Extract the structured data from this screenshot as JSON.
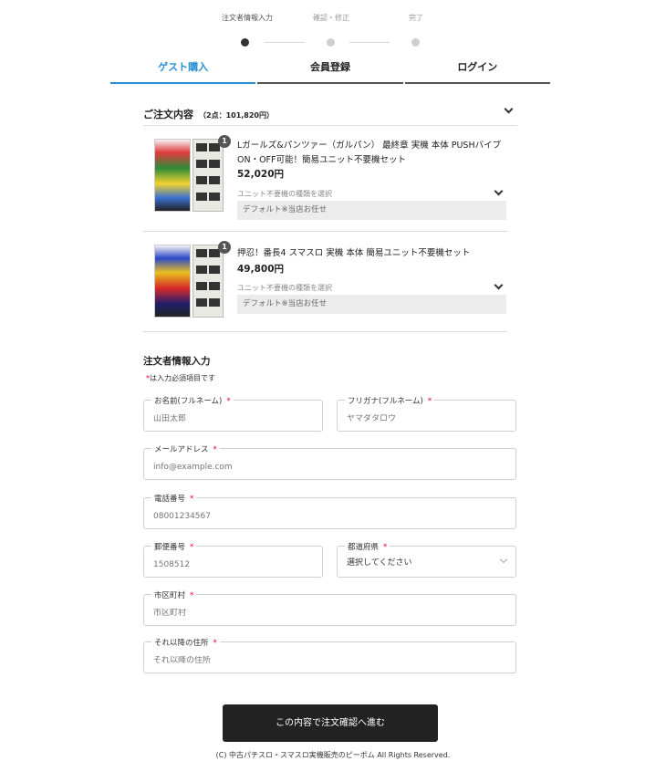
{
  "stepper": {
    "steps": [
      {
        "label": "注文者情報入力",
        "active": true
      },
      {
        "label": "確認・修正",
        "active": false
      },
      {
        "label": "完了",
        "active": false
      }
    ]
  },
  "tabs": [
    {
      "label": "ゲスト購入",
      "active": true
    },
    {
      "label": "会員登録",
      "active": false
    },
    {
      "label": "ログイン",
      "active": false
    }
  ],
  "order": {
    "title": "ご注文内容",
    "count": "（2点：101,820円）",
    "items": [
      {
        "qty": "1",
        "name": "Lガールズ&パンツァー（ガルパン） 最終章 実機 本体 PUSHバイブON・OFF可能！簡易ユニット不要機セット",
        "price": "52,020円",
        "unit_label": "ユニット不要機の種類を選択",
        "unit_value": "デフォルト※当店お任せ"
      },
      {
        "qty": "1",
        "name": "押忍！番長4 スマスロ 実機 本体 簡易ユニット不要機セット",
        "price": "49,800円",
        "unit_label": "ユニット不要機の種類を選択",
        "unit_value": "デフォルト※当店お任せ"
      }
    ]
  },
  "form": {
    "title": "注文者情報入力",
    "required_note": "は入力必須項目です",
    "required_mark": "*",
    "fields": {
      "name": {
        "label": "お名前(フルネーム)",
        "placeholder": "山田太郎"
      },
      "kana": {
        "label": "フリガナ(フルネーム)",
        "placeholder": "ヤマダタロウ"
      },
      "email": {
        "label": "メールアドレス",
        "placeholder": "info@example.com"
      },
      "phone": {
        "label": "電話番号",
        "placeholder": "08001234567"
      },
      "zip": {
        "label": "郵便番号",
        "placeholder": "1508512"
      },
      "pref": {
        "label": "都道府県",
        "value": "選択してください"
      },
      "city": {
        "label": "市区町村",
        "placeholder": "市区町村"
      },
      "address": {
        "label": "それ以降の住所",
        "placeholder": "それ以降の住所"
      }
    }
  },
  "submit_label": "この内容で注文確認へ進む",
  "footer": "(C) 中古パチスロ・スマスロ実機販売のピーボム All Rights Reserved.",
  "colors": {
    "accent": "#2a8fd4",
    "required": "#e2002f",
    "button": "#222222"
  }
}
